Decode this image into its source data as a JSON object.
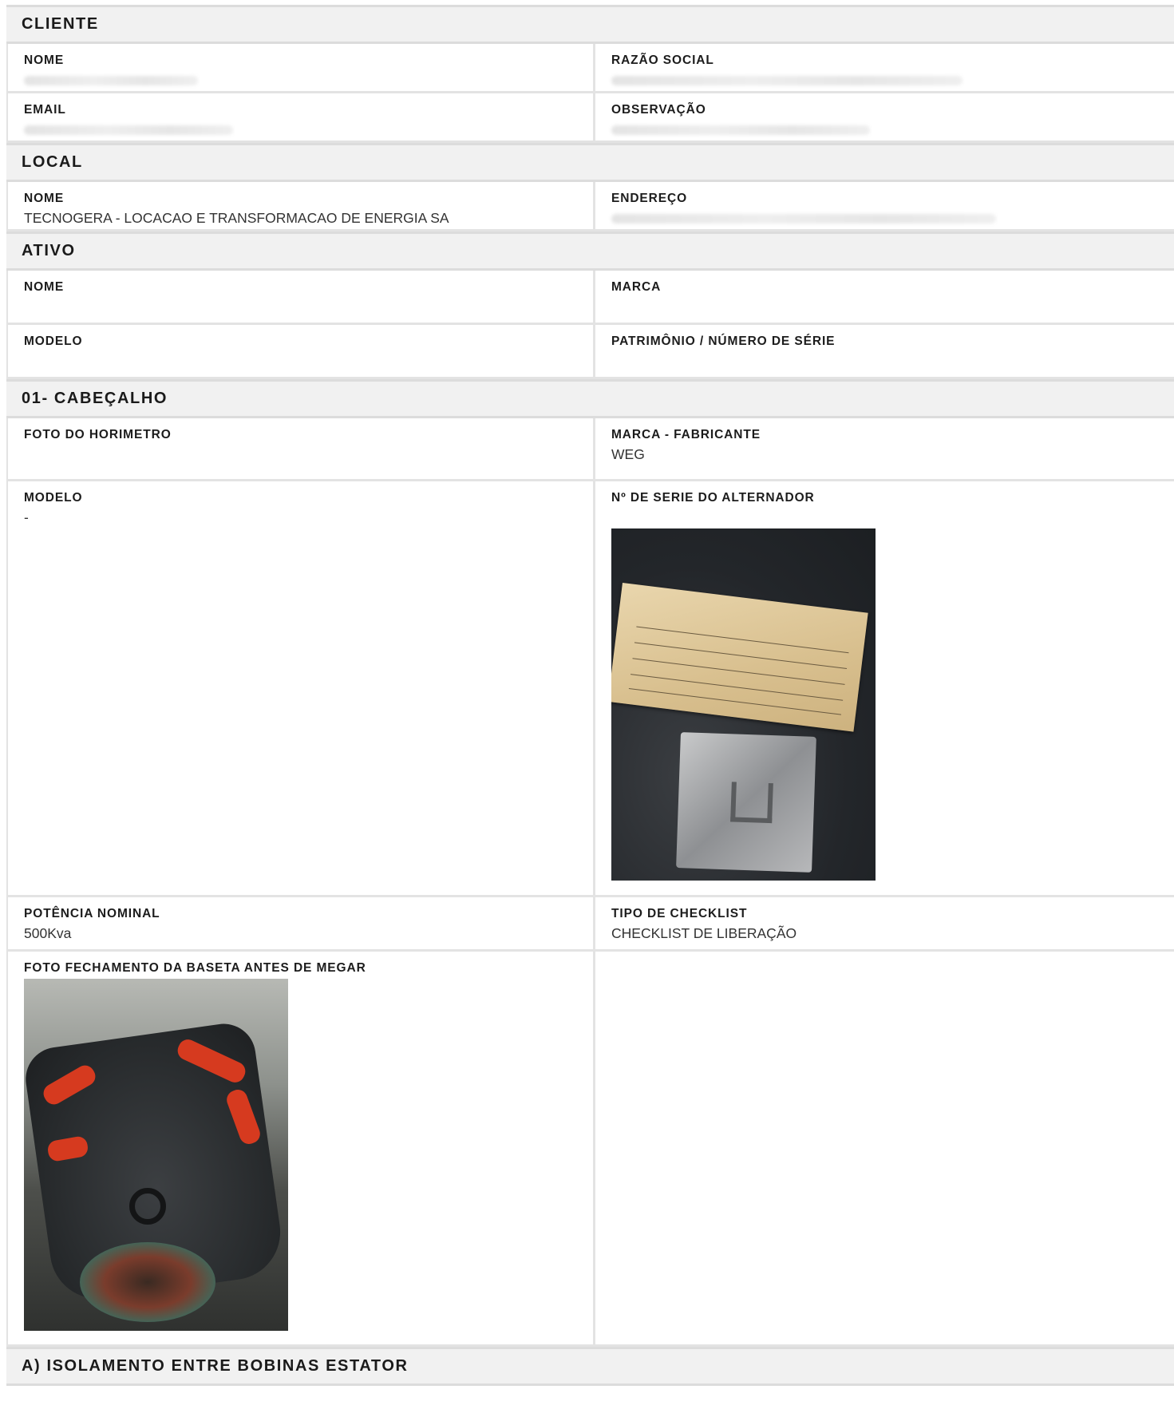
{
  "sections": {
    "cliente": {
      "title": "CLIENTE",
      "nome_label": "NOME",
      "razao_label": "RAZÃO SOCIAL",
      "email_label": "EMAIL",
      "observacao_label": "OBSERVAÇÃO"
    },
    "local": {
      "title": "LOCAL",
      "nome_label": "NOME",
      "nome_value": "TECNOGERA - LOCACAO E TRANSFORMACAO DE ENERGIA SA",
      "endereco_label": "ENDEREÇO"
    },
    "ativo": {
      "title": "ATIVO",
      "nome_label": "NOME",
      "marca_label": "MARCA",
      "modelo_label": "MODELO",
      "patrimonio_label": "PATRIMÔNIO / NÚMERO DE SÉRIE"
    },
    "cabecalho": {
      "title": "01- CABEÇALHO",
      "foto_horimetro_label": "FOTO DO HORIMETRO",
      "marca_fabricante_label": "MARCA - FABRICANTE",
      "marca_fabricante_value": "WEG",
      "modelo_label": "MODELO",
      "modelo_value": "-",
      "serie_alternador_label": "Nº DE SERIE DO ALTERNADOR",
      "potencia_label": "POTÊNCIA NOMINAL",
      "potencia_value": "500Kva",
      "tipo_checklist_label": "TIPO DE CHECKLIST",
      "tipo_checklist_value": "CHECKLIST DE LIBERAÇÃO",
      "foto_baseta_label": "FOTO FECHAMENTO DA BASETA ANTES DE MEGAR"
    },
    "isolamento": {
      "title": "A) ISOLAMENTO ENTRE BOBINAS ESTATOR"
    }
  }
}
